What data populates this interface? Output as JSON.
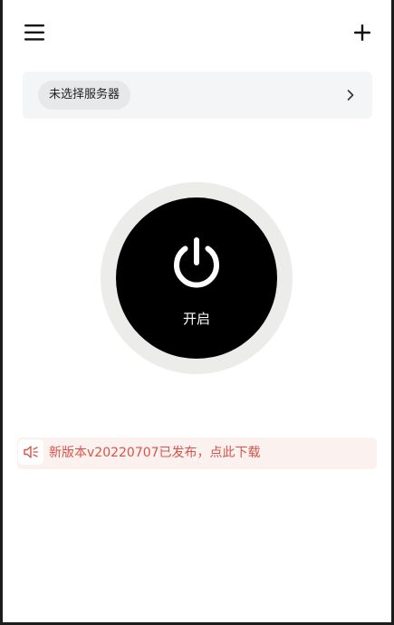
{
  "header": {
    "menu_icon": "hamburger-menu-icon",
    "add_icon": "plus-icon"
  },
  "server": {
    "label": "未选择服务器",
    "chevron_icon": "chevron-right-icon"
  },
  "power": {
    "label": "开启",
    "icon": "power-icon"
  },
  "notice": {
    "icon": "speaker-icon",
    "text": "新版本v20220707已发布，点此下载"
  },
  "colors": {
    "power_button": "#000000",
    "power_ring": "#ececeb",
    "notice_text": "#d9534a",
    "notice_background": "#fbf1ef",
    "card_background": "#f3f5f6"
  }
}
